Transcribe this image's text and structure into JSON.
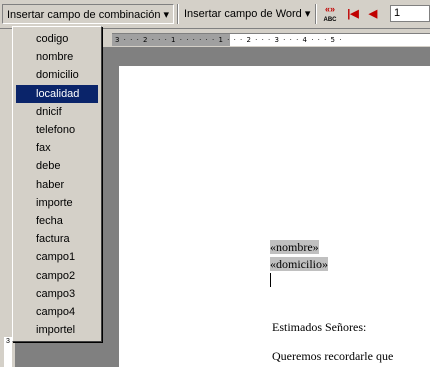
{
  "toolbar": {
    "insert_merge_field": "Insertar campo de combinación ▾",
    "insert_word_field": "Insertar campo de Word ▾",
    "view_merged_icon": "«»",
    "view_merged_sub": "ABC",
    "first_record_icon": "|◀",
    "prev_record_icon": "◀",
    "record_number": "1"
  },
  "ruler": {
    "marks": "3 · · · 2 · · · 1 · · ·  · · · 1 · · · 2 · · · 3 · · · 4 · · · 5 ·"
  },
  "vruler": {
    "mark": "3"
  },
  "dropdown": {
    "items": [
      "codigo",
      "nombre",
      "domicilio",
      "localidad",
      "dnicif",
      "telefono",
      "fax",
      "debe",
      "haber",
      "importe",
      "fecha",
      "factura",
      "campo1",
      "campo2",
      "campo3",
      "campo4",
      "importel"
    ],
    "selected": "localidad"
  },
  "document": {
    "field_nombre": "«nombre»",
    "field_domicilio": "«domicilio»",
    "greeting": "Estimados Señores:",
    "body": "Queremos   recordarle   que"
  }
}
